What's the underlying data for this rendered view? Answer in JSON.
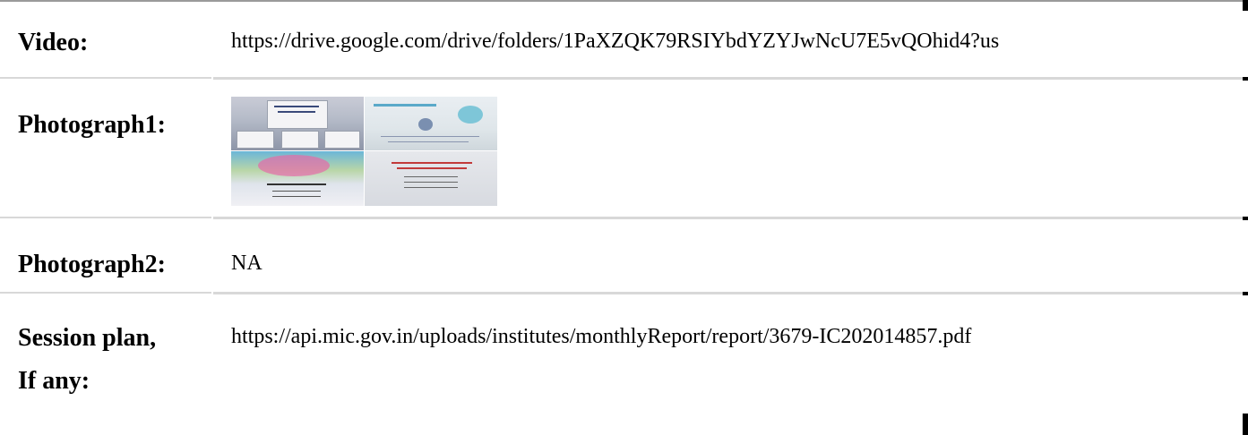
{
  "rows": [
    {
      "label": "Video:",
      "value": "https://drive.google.com/drive/folders/1PaXZQK79RSIYbdYZYJwNcU7E5vQOhid4?us"
    },
    {
      "label": "Photograph1:",
      "image": "photo-collage-thumbnail"
    },
    {
      "label": "Photograph2:",
      "value": "NA"
    },
    {
      "label_line1": "Session plan,",
      "label_line2": "If any:",
      "value": "https://api.mic.gov.in/uploads/institutes/monthlyReport/report/3679-IC202014857.pdf"
    }
  ],
  "colors": {
    "rule": "#d8d8d8",
    "text": "#000000"
  }
}
